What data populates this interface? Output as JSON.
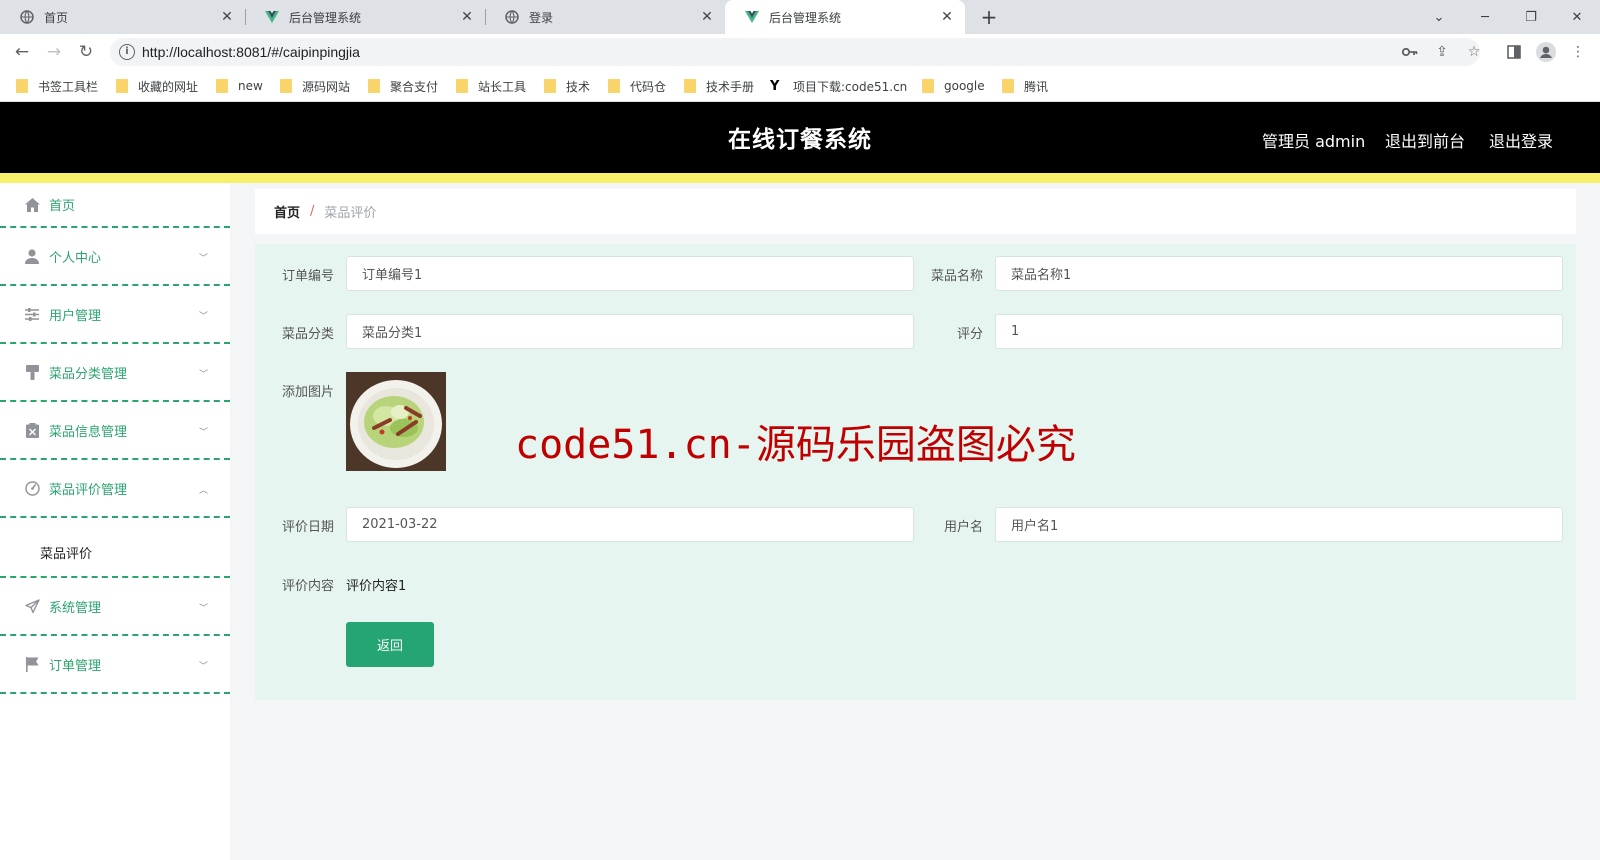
{
  "browser": {
    "tabs": [
      {
        "title": "首页",
        "icon": "globe-icon"
      },
      {
        "title": "后台管理系统",
        "icon": "vue-icon"
      },
      {
        "title": "登录",
        "icon": "globe-icon"
      },
      {
        "title": "后台管理系统",
        "icon": "vue-icon",
        "active": true
      }
    ],
    "url": "http://localhost:8081/#/caipinpingjia",
    "bookmarks": [
      "书签工具栏",
      "收藏的网址",
      "new",
      "源码网站",
      "聚合支付",
      "站长工具",
      "技术",
      "代码仓",
      "技术手册",
      "项目下载:code51.cn",
      "google",
      "腾讯"
    ]
  },
  "app": {
    "title": "在线订餐系统",
    "user_label": "管理员 admin",
    "to_front": "退出到前台",
    "logout": "退出登录",
    "accent": "#2ba56f",
    "header_bg": "#000000",
    "stripe": "#f6f06a"
  },
  "sidebar": {
    "items": [
      {
        "label": "首页",
        "icon": "home-icon"
      },
      {
        "label": "个人中心",
        "icon": "user-icon"
      },
      {
        "label": "用户管理",
        "icon": "sliders-icon"
      },
      {
        "label": "菜品分类管理",
        "icon": "brush-icon"
      },
      {
        "label": "菜品信息管理",
        "icon": "clipboard-icon"
      },
      {
        "label": "菜品评价管理",
        "icon": "gauge-icon"
      },
      {
        "label": "系统管理",
        "icon": "send-icon"
      },
      {
        "label": "订单管理",
        "icon": "flag-icon"
      }
    ],
    "subitem": "菜品评价"
  },
  "breadcrumb": {
    "home": "首页",
    "separator": "/",
    "current": "菜品评价"
  },
  "form": {
    "order_no_label": "订单编号",
    "order_no": "订单编号1",
    "dish_name_label": "菜品名称",
    "dish_name": "菜品名称1",
    "category_label": "菜品分类",
    "category": "菜品分类1",
    "score_label": "评分",
    "score": "1",
    "image_label": "添加图片",
    "date_label": "评价日期",
    "date": "2021-03-22",
    "username_label": "用户名",
    "username": "用户名1",
    "content_label": "评价内容",
    "content": "评价内容1",
    "back": "返回"
  },
  "watermark": "code51.cn-源码乐园盗图必究"
}
